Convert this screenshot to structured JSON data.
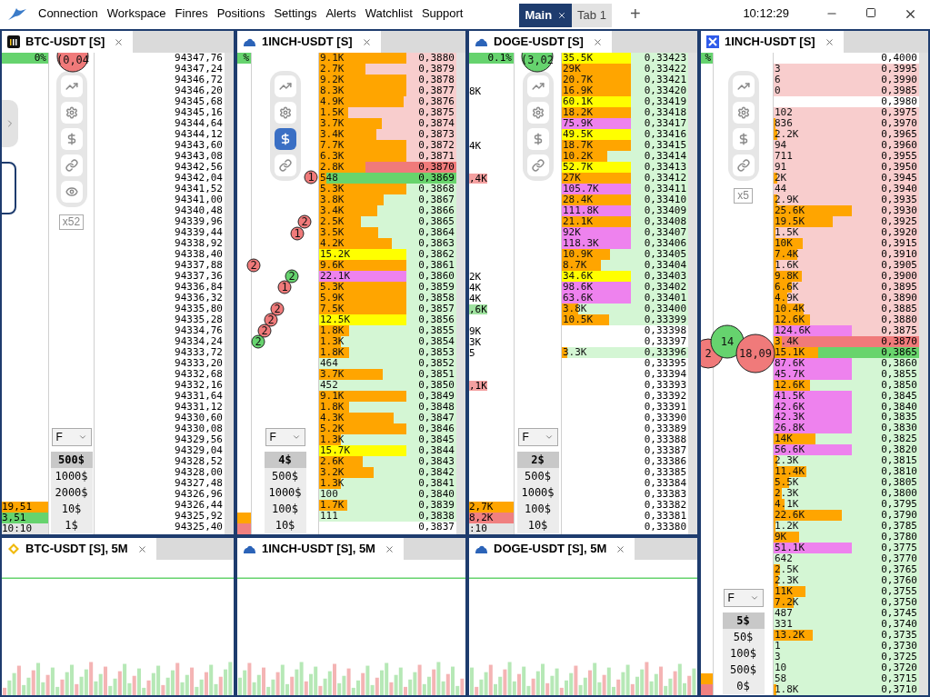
{
  "menu": [
    "Connection",
    "Workspace",
    "Finres",
    "Positions",
    "Settings",
    "Alerts",
    "Watchlist",
    "Support"
  ],
  "tabs": [
    {
      "label": "Main",
      "selected": true
    },
    {
      "label": "Tab 1",
      "selected": false
    }
  ],
  "add_tab": "+",
  "clock": "10:12:29",
  "ladders": [
    {
      "title": "BTC-USDT [S]",
      "percent": "0%",
      "trades": [
        {
          "label": "(0,04",
          "color": "#f07a7a"
        }
      ],
      "tools": [
        {
          "kind": "trend",
          "selected": false
        },
        {
          "kind": "settings",
          "selected": false
        },
        {
          "kind": "dollar",
          "selected": false
        },
        {
          "kind": "link",
          "selected": false
        },
        {
          "kind": "eye",
          "selected": false
        }
      ],
      "multiplier": "x52",
      "mode": "F",
      "sizes": [
        {
          "label": "500$",
          "selected": true
        },
        {
          "label": "1000$",
          "selected": false
        },
        {
          "label": "2000$",
          "selected": false
        },
        {
          "label": "10$",
          "selected": false
        },
        {
          "label": "1$",
          "selected": false
        }
      ],
      "footer": [
        {
          "text": "19,51",
          "color": "#ffa500"
        },
        {
          "text": "3,51",
          "color": "#66d36e"
        },
        {
          "text": "10:10",
          "color": "#e4e4e4"
        }
      ],
      "rows": [
        {
          "price": "94347,76"
        },
        {
          "price": "94347,24"
        },
        {
          "price": "94346,72"
        },
        {
          "price": "94346,20"
        },
        {
          "price": "94345,68"
        },
        {
          "price": "94345,16"
        },
        {
          "price": "94344,64"
        },
        {
          "price": "94344,12"
        },
        {
          "price": "94343,60"
        },
        {
          "price": "94343,08"
        },
        {
          "price": "94342,56"
        },
        {
          "price": "94342,04"
        },
        {
          "price": "94341,52"
        },
        {
          "price": "94341,00"
        },
        {
          "price": "94340,48"
        },
        {
          "price": "94339,96"
        },
        {
          "price": "94339,44"
        },
        {
          "price": "94338,92"
        },
        {
          "price": "94338,40"
        },
        {
          "price": "94337,88"
        },
        {
          "price": "94337,36"
        },
        {
          "price": "94336,84"
        },
        {
          "price": "94336,32"
        },
        {
          "price": "94335,80"
        },
        {
          "price": "94335,28"
        },
        {
          "price": "94334,76"
        },
        {
          "price": "94334,24"
        },
        {
          "price": "94333,72"
        },
        {
          "price": "94333,20"
        },
        {
          "price": "94332,68"
        },
        {
          "price": "94332,16"
        },
        {
          "price": "94331,64"
        },
        {
          "price": "94331,12"
        },
        {
          "price": "94330,60"
        },
        {
          "price": "94330,08"
        },
        {
          "price": "94329,56"
        },
        {
          "price": "94329,04"
        },
        {
          "price": "94328,52"
        },
        {
          "price": "94328,00"
        },
        {
          "price": "94327,48"
        },
        {
          "price": "94326,96"
        },
        {
          "price": "94326,44"
        },
        {
          "price": "94325,92"
        },
        {
          "price": "94325,40"
        }
      ]
    },
    {
      "title": "1INCH-USDT [S]",
      "percent": "%",
      "trades": [
        {
          "label": "1",
          "color": "#f07a7a"
        },
        {
          "label": "2",
          "color": "#f07a7a"
        },
        {
          "label": "1",
          "color": "#f07a7a"
        },
        {
          "label": "2",
          "color": "#f07a7a"
        },
        {
          "label": "2",
          "color": "#66d36e"
        },
        {
          "label": "1",
          "color": "#f07a7a"
        },
        {
          "label": "2",
          "color": "#f07a7a"
        },
        {
          "label": "2",
          "color": "#f07a7a"
        },
        {
          "label": "2",
          "color": "#f07a7a"
        },
        {
          "label": "2",
          "color": "#66d36e"
        }
      ],
      "tools": [
        {
          "kind": "trend",
          "selected": false
        },
        {
          "kind": "settings",
          "selected": false
        },
        {
          "kind": "dollar",
          "selected": true
        },
        {
          "kind": "link",
          "selected": false
        }
      ],
      "mode": "F",
      "sizes": [
        {
          "label": "4$",
          "selected": true
        },
        {
          "label": "500$",
          "selected": false
        },
        {
          "label": "1000$",
          "selected": false
        },
        {
          "label": "100$",
          "selected": false
        },
        {
          "label": "10$",
          "selected": false
        }
      ],
      "footer": [
        {
          "color": "#ffa500"
        },
        {
          "color": "#f08080"
        }
      ],
      "rows": [
        {
          "price": "0,3880",
          "volume": "9.1K",
          "level": 1,
          "color": "#ffa500",
          "kind": "ask"
        },
        {
          "price": "0,3879",
          "volume": "2.7K",
          "level": 0.53,
          "color": "#ffa500",
          "kind": "ask"
        },
        {
          "price": "0,3878",
          "volume": "9.2K",
          "level": 1,
          "color": "#ffa500",
          "kind": "ask"
        },
        {
          "price": "0,3877",
          "volume": "8.3K",
          "level": 1,
          "color": "#ffa500",
          "kind": "ask"
        },
        {
          "price": "0,3876",
          "volume": "4.9K",
          "level": 0.97,
          "color": "#ffa500",
          "kind": "ask"
        },
        {
          "price": "0,3875",
          "volume": "1.5K",
          "level": 0.33,
          "color": "#ffa500",
          "kind": "ask"
        },
        {
          "price": "0,3874",
          "volume": "3.7K",
          "level": 0.72,
          "color": "#ffa500",
          "kind": "ask"
        },
        {
          "price": "0,3873",
          "volume": "3.4K",
          "level": 0.66,
          "color": "#ffa500",
          "kind": "ask"
        },
        {
          "price": "0,3872",
          "volume": "7.7K",
          "level": 1,
          "color": "#ffa500",
          "kind": "ask"
        },
        {
          "price": "0,3871",
          "volume": "6.3K",
          "level": 1,
          "color": "#ffa500",
          "kind": "ask"
        },
        {
          "price": "0,3870",
          "volume": "2.8K",
          "level": 0.53,
          "color": "#ffa500",
          "kind": "best_ask"
        },
        {
          "price": "0,3869",
          "volume": "548",
          "level": 0.08,
          "color": "#ffa500",
          "kind": "best_bid"
        },
        {
          "price": "0,3868",
          "volume": "5.3K",
          "level": 1,
          "color": "#ffa500",
          "kind": "bid"
        },
        {
          "price": "0,3867",
          "volume": "3.8K",
          "level": 0.74,
          "color": "#ffa500",
          "kind": "bid"
        },
        {
          "price": "0,3866",
          "volume": "3.4K",
          "level": 0.67,
          "color": "#ffa500",
          "kind": "bid"
        },
        {
          "price": "0,3865",
          "volume": "2.5K",
          "level": 0.48,
          "color": "#ffa500",
          "kind": "bid"
        },
        {
          "price": "0,3864",
          "volume": "3.5K",
          "level": 0.68,
          "color": "#ffa500",
          "kind": "bid"
        },
        {
          "price": "0,3863",
          "volume": "4.2K",
          "level": 0.83,
          "color": "#ffa500",
          "kind": "bid"
        },
        {
          "price": "0,3862",
          "volume": "15.2K",
          "level": 1,
          "color": "#ffff00",
          "kind": "bid"
        },
        {
          "price": "0,3861",
          "volume": "9.6K",
          "level": 1,
          "color": "#ffa500",
          "kind": "bid"
        },
        {
          "price": "0,3860",
          "volume": "22.1K",
          "level": 1,
          "color": "#ee82ee",
          "kind": "bid"
        },
        {
          "price": "0,3859",
          "volume": "5.3K",
          "level": 1,
          "color": "#ffa500",
          "kind": "bid"
        },
        {
          "price": "0,3858",
          "volume": "5.9K",
          "level": 1,
          "color": "#ffa500",
          "kind": "bid"
        },
        {
          "price": "0,3857",
          "volume": "7.5K",
          "level": 1,
          "color": "#ffa500",
          "kind": "bid"
        },
        {
          "price": "0,3856",
          "volume": "12.5K",
          "level": 1,
          "color": "#ffff00",
          "kind": "bid"
        },
        {
          "price": "0,3855",
          "volume": "1.8K",
          "level": 0.34,
          "color": "#ffa500",
          "kind": "bid"
        },
        {
          "price": "0,3854",
          "volume": "1.3K",
          "level": 0.25,
          "color": "#ffa500",
          "kind": "bid"
        },
        {
          "price": "0,3853",
          "volume": "1.8K",
          "level": 0.34,
          "color": "#ffa500",
          "kind": "bid"
        },
        {
          "price": "0,3852",
          "volume": "464",
          "kind": "bid"
        },
        {
          "price": "0,3851",
          "volume": "3.7K",
          "level": 0.73,
          "color": "#ffa500",
          "kind": "bid"
        },
        {
          "price": "0,3850",
          "volume": "452",
          "kind": "bid"
        },
        {
          "price": "0,3849",
          "volume": "9.1K",
          "level": 1,
          "color": "#ffa500",
          "kind": "bid"
        },
        {
          "price": "0,3848",
          "volume": "1.8K",
          "level": 0.34,
          "color": "#ffa500",
          "kind": "bid"
        },
        {
          "price": "0,3847",
          "volume": "4.3K",
          "level": 0.85,
          "color": "#ffa500",
          "kind": "bid"
        },
        {
          "price": "0,3846",
          "volume": "5.2K",
          "level": 1,
          "color": "#ffa500",
          "kind": "bid"
        },
        {
          "price": "0,3845",
          "volume": "1.3K",
          "level": 0.25,
          "color": "#ffa500",
          "kind": "bid"
        },
        {
          "price": "0,3844",
          "volume": "15.7K",
          "level": 1,
          "color": "#ffff00",
          "kind": "bid"
        },
        {
          "price": "0,3843",
          "volume": "2.6K",
          "level": 0.5,
          "color": "#ffa500",
          "kind": "bid"
        },
        {
          "price": "0,3842",
          "volume": "3.2K",
          "level": 0.62,
          "color": "#ffa500",
          "kind": "bid"
        },
        {
          "price": "0,3841",
          "volume": "1.3K",
          "level": 0.25,
          "color": "#ffa500",
          "kind": "bid"
        },
        {
          "price": "0,3840",
          "volume": "100",
          "kind": "bid"
        },
        {
          "price": "0,3839",
          "volume": "1.7K",
          "level": 0.32,
          "color": "#ffa500",
          "kind": "bid"
        },
        {
          "price": "0,3838",
          "volume": "111",
          "kind": "bid"
        },
        {
          "price": "0,3837"
        }
      ]
    },
    {
      "title": "DOGE-USDT [S]",
      "percent": "0.1%",
      "trades": [
        {
          "label": "(3,02",
          "color": "#66d36e"
        }
      ],
      "tools": [
        {
          "kind": "trend",
          "selected": false
        },
        {
          "kind": "settings",
          "selected": false
        },
        {
          "kind": "dollar",
          "selected": false
        },
        {
          "kind": "link",
          "selected": false
        }
      ],
      "mode": "F",
      "sizes": [
        {
          "label": "2$",
          "selected": true
        },
        {
          "label": "500$",
          "selected": false
        },
        {
          "label": "1000$",
          "selected": false
        },
        {
          "label": "100$",
          "selected": false
        },
        {
          "label": "10$",
          "selected": false
        }
      ],
      "footer": [
        {
          "text": "2,7K",
          "color": "#ffa500"
        },
        {
          "text": "8,2K",
          "color": "#f08080"
        },
        {
          "text": ":10",
          "color": "#e4e4e4"
        }
      ],
      "rows": [
        {
          "price": "0,33423",
          "volume": "35.5K",
          "level": 1,
          "color": "#ffff00",
          "kind": "bid"
        },
        {
          "price": "0,33422",
          "volume": "29K",
          "level": 1,
          "color": "#ffa500",
          "kind": "bid"
        },
        {
          "price": "0,33421",
          "volume": "20.7K",
          "level": 1,
          "color": "#ffa500",
          "kind": "bid"
        },
        {
          "price": "0,33420",
          "volume": "16.9K",
          "level": 1,
          "color": "#ffa500",
          "kind": "bid",
          "cluster": {
            "text": "8K"
          }
        },
        {
          "price": "0,33419",
          "volume": "60.1K",
          "level": 1,
          "color": "#ffff00",
          "kind": "bid"
        },
        {
          "price": "0,33418",
          "volume": "18.2K",
          "level": 1,
          "color": "#ffa500",
          "kind": "bid"
        },
        {
          "price": "0,33417",
          "volume": "75.9K",
          "level": 1,
          "color": "#ee82ee",
          "kind": "bid"
        },
        {
          "price": "0,33416",
          "volume": "49.5K",
          "level": 1,
          "color": "#ffff00",
          "kind": "bid"
        },
        {
          "price": "0,33415",
          "volume": "18.7K",
          "level": 1,
          "color": "#ffa500",
          "kind": "bid",
          "cluster": {
            "text": "4K"
          }
        },
        {
          "price": "0,33414",
          "volume": "10.2K",
          "level": 0.66,
          "color": "#ffa500",
          "kind": "bid"
        },
        {
          "price": "0,33413",
          "volume": "52.7K",
          "level": 1,
          "color": "#ffff00",
          "kind": "bid"
        },
        {
          "price": "0,33412",
          "volume": "27K",
          "level": 1,
          "color": "#ffa500",
          "kind": "bid",
          "cluster": {
            "text": ",4K",
            "color": "#f4a0a0"
          }
        },
        {
          "price": "0,33411",
          "volume": "105.7K",
          "level": 1,
          "color": "#ee82ee",
          "kind": "bid"
        },
        {
          "price": "0,33410",
          "volume": "28.4K",
          "level": 1,
          "color": "#ffa500",
          "kind": "bid"
        },
        {
          "price": "0,33409",
          "volume": "111.8K",
          "level": 1,
          "color": "#ee82ee",
          "kind": "bid"
        },
        {
          "price": "0,33408",
          "volume": "21.1K",
          "level": 1,
          "color": "#ffa500",
          "kind": "bid"
        },
        {
          "price": "0,33407",
          "volume": "92K",
          "level": 1,
          "color": "#ee82ee",
          "kind": "bid"
        },
        {
          "price": "0,33406",
          "volume": "118.3K",
          "level": 1,
          "color": "#ee82ee",
          "kind": "bid"
        },
        {
          "price": "0,33405",
          "volume": "10.9K",
          "level": 0.7,
          "color": "#ffa500",
          "kind": "bid"
        },
        {
          "price": "0,33404",
          "volume": "8.7K",
          "level": 0.56,
          "color": "#ffa500",
          "kind": "bid"
        },
        {
          "price": "0,33403",
          "volume": "34.6K",
          "level": 1,
          "color": "#ffff00",
          "kind": "bid",
          "cluster": {
            "text": "2K"
          }
        },
        {
          "price": "0,33402",
          "volume": "98.6K",
          "level": 1,
          "color": "#ee82ee",
          "kind": "bid",
          "cluster": {
            "text": "4K"
          }
        },
        {
          "price": "0,33401",
          "volume": "63.6K",
          "level": 1,
          "color": "#ee82ee",
          "kind": "bid",
          "cluster": {
            "text": "4K"
          }
        },
        {
          "price": "0,33400",
          "volume": "3.8K",
          "level": 0.24,
          "color": "#ffa500",
          "kind": "bid",
          "cluster": {
            "text": ",6K",
            "color": "#9fe29f"
          }
        },
        {
          "price": "0,33399",
          "volume": "10.5K",
          "level": 0.68,
          "color": "#ffa500",
          "kind": "bid"
        },
        {
          "price": "0,33398",
          "cluster": {
            "text": "9K"
          }
        },
        {
          "price": "0,33397",
          "cluster": {
            "text": "3K"
          }
        },
        {
          "price": "0,33396",
          "volume": "3.3K",
          "level": 0.08,
          "color": "#ffa500",
          "kind": "bid",
          "cluster": {
            "text": "5"
          }
        },
        {
          "price": "0,33395"
        },
        {
          "price": "0,33394"
        },
        {
          "price": "0,33393",
          "cluster": {
            "text": ",1K",
            "color": "#f4a0a0"
          }
        },
        {
          "price": "0,33392"
        },
        {
          "price": "0,33391"
        },
        {
          "price": "0,33390"
        },
        {
          "price": "0,33389"
        },
        {
          "price": "0,33388"
        },
        {
          "price": "0,33387"
        },
        {
          "price": "0,33386"
        },
        {
          "price": "0,33385"
        },
        {
          "price": "0,33384"
        },
        {
          "price": "0,33383"
        },
        {
          "price": "0,33382"
        },
        {
          "price": "0,33381"
        },
        {
          "price": "0,33380"
        }
      ]
    },
    {
      "title": "1INCH-USDT [S]",
      "percent": "%",
      "trades": [
        {
          "label": "2",
          "color": "#f07a7a"
        },
        {
          "label": "14",
          "color": "#66d36e"
        },
        {
          "label": "18,09",
          "color": "#f07a7a"
        }
      ],
      "tools": [
        {
          "kind": "trend",
          "selected": false
        },
        {
          "kind": "settings",
          "selected": false
        },
        {
          "kind": "dollar",
          "selected": false
        },
        {
          "kind": "link",
          "selected": false
        }
      ],
      "multiplier": "x5",
      "mode": "F",
      "sizes": [
        {
          "label": "5$",
          "selected": true
        },
        {
          "label": "50$",
          "selected": false
        },
        {
          "label": "100$",
          "selected": false
        },
        {
          "label": "500$",
          "selected": false
        },
        {
          "label": "0$",
          "selected": false
        }
      ],
      "footer": [
        {
          "color": "#ffa500"
        },
        {
          "color": "#f08080"
        }
      ],
      "rows": [
        {
          "price": "0,4000"
        },
        {
          "price": "0,3995",
          "volume": "3",
          "kind": "ask"
        },
        {
          "price": "0,3990",
          "volume": "6",
          "kind": "ask"
        },
        {
          "price": "0,3985",
          "volume": "0",
          "kind": "ask"
        },
        {
          "price": "0,3980"
        },
        {
          "price": "0,3975",
          "volume": "102",
          "kind": "ask"
        },
        {
          "price": "0,3970",
          "volume": "836",
          "level": 0.02,
          "color": "#ffa500",
          "kind": "ask"
        },
        {
          "price": "0,3965",
          "volume": "2.2K",
          "level": 0.05,
          "color": "#ffa500",
          "kind": "ask"
        },
        {
          "price": "0,3960",
          "volume": "94",
          "kind": "ask"
        },
        {
          "price": "0,3955",
          "volume": "711",
          "kind": "ask"
        },
        {
          "price": "0,3950",
          "volume": "91",
          "kind": "ask"
        },
        {
          "price": "0,3945",
          "volume": "2K",
          "level": 0.05,
          "color": "#ffa500",
          "kind": "ask"
        },
        {
          "price": "0,3940",
          "volume": "44",
          "kind": "ask"
        },
        {
          "price": "0,3935",
          "volume": "2.9K",
          "level": 0.05,
          "color": "#ffa500",
          "kind": "ask"
        },
        {
          "price": "0,3930",
          "volume": "25.6K",
          "level": 1,
          "color": "#ffa500",
          "kind": "ask"
        },
        {
          "price": "0,3925",
          "volume": "19.5K",
          "level": 0.75,
          "color": "#ffa500",
          "kind": "ask"
        },
        {
          "price": "0,3920",
          "volume": "1.5K",
          "level": 0.02,
          "color": "#ffa500",
          "kind": "ask"
        },
        {
          "price": "0,3915",
          "volume": "10K",
          "level": 0.37,
          "color": "#ffa500",
          "kind": "ask"
        },
        {
          "price": "0,3910",
          "volume": "7.4K",
          "level": 0.3,
          "color": "#ffa500",
          "kind": "ask"
        },
        {
          "price": "0,3905",
          "volume": "1.6K",
          "level": 0.03,
          "color": "#ffa500",
          "kind": "ask"
        },
        {
          "price": "0,3900",
          "volume": "9.8K",
          "level": 0.36,
          "color": "#ffa500",
          "kind": "ask"
        },
        {
          "price": "0,3895",
          "volume": "6.6K",
          "level": 0.23,
          "color": "#ffa500",
          "kind": "ask"
        },
        {
          "price": "0,3890",
          "volume": "4.9K",
          "level": 0.17,
          "color": "#ffa500",
          "kind": "ask"
        },
        {
          "price": "0,3885",
          "volume": "10.4K",
          "level": 0.38,
          "color": "#ffa500",
          "kind": "ask"
        },
        {
          "price": "0,3880",
          "volume": "12.6K",
          "level": 0.47,
          "color": "#ffa500",
          "kind": "ask"
        },
        {
          "price": "0,3875",
          "volume": "124.6K",
          "level": 1,
          "color": "#ee82ee",
          "kind": "ask"
        },
        {
          "price": "0,3870",
          "volume": "3.4K",
          "level": 0.1,
          "color": "#ffa500",
          "kind": "best_ask"
        },
        {
          "price": "0,3865",
          "volume": "15.1K",
          "level": 0.57,
          "color": "#ffa500",
          "kind": "best_bid"
        },
        {
          "price": "0,3860",
          "volume": "87.6K",
          "level": 1,
          "color": "#ee82ee",
          "kind": "bid"
        },
        {
          "price": "0,3855",
          "volume": "45.7K",
          "level": 1,
          "color": "#ee82ee",
          "kind": "bid"
        },
        {
          "price": "0,3850",
          "volume": "12.6K",
          "level": 0.47,
          "color": "#ffa500",
          "kind": "bid"
        },
        {
          "price": "0,3845",
          "volume": "41.5K",
          "level": 1,
          "color": "#ee82ee",
          "kind": "bid"
        },
        {
          "price": "0,3840",
          "volume": "42.6K",
          "level": 1,
          "color": "#ee82ee",
          "kind": "bid"
        },
        {
          "price": "0,3835",
          "volume": "42.3K",
          "level": 1,
          "color": "#ee82ee",
          "kind": "bid"
        },
        {
          "price": "0,3830",
          "volume": "26.8K",
          "level": 1,
          "color": "#ee82ee",
          "kind": "bid"
        },
        {
          "price": "0,3825",
          "volume": "14K",
          "level": 0.53,
          "color": "#ffa500",
          "kind": "bid"
        },
        {
          "price": "0,3820",
          "volume": "56.6K",
          "level": 1,
          "color": "#ee82ee",
          "kind": "bid"
        },
        {
          "price": "0,3815",
          "volume": "2.3K",
          "level": 0.05,
          "color": "#ffa500",
          "kind": "bid"
        },
        {
          "price": "0,3810",
          "volume": "11.4K",
          "level": 0.42,
          "color": "#ffa500",
          "kind": "bid"
        },
        {
          "price": "0,3805",
          "volume": "5.5K",
          "level": 0.2,
          "color": "#ffa500",
          "kind": "bid"
        },
        {
          "price": "0,3800",
          "volume": "2.3K",
          "level": 0.1,
          "color": "#ffa500",
          "kind": "bid"
        },
        {
          "price": "0,3795",
          "volume": "4.1K",
          "level": 0.14,
          "color": "#ffa500",
          "kind": "bid"
        },
        {
          "price": "0,3790",
          "volume": "22.6K",
          "level": 0.87,
          "color": "#ffa500",
          "kind": "bid"
        },
        {
          "price": "0,3785",
          "volume": "1.2K",
          "level": 0.02,
          "color": "#ffa500",
          "kind": "bid"
        },
        {
          "price": "0,3780",
          "volume": "9K",
          "level": 0.33,
          "color": "#ffa500",
          "kind": "bid"
        },
        {
          "price": "0,3775",
          "volume": "51.1K",
          "level": 1,
          "color": "#ee82ee",
          "kind": "bid"
        },
        {
          "price": "0,3770",
          "volume": "642",
          "kind": "bid"
        },
        {
          "price": "0,3765",
          "volume": "2.5K",
          "level": 0.08,
          "color": "#ffa500",
          "kind": "bid"
        },
        {
          "price": "0,3760",
          "volume": "2.3K",
          "level": 0.06,
          "color": "#ffa500",
          "kind": "bid"
        },
        {
          "price": "0,3755",
          "volume": "11K",
          "level": 0.41,
          "color": "#ffa500",
          "kind": "bid"
        },
        {
          "price": "0,3750",
          "volume": "7.2K",
          "level": 0.26,
          "color": "#ffa500",
          "kind": "bid"
        },
        {
          "price": "0,3745",
          "volume": "487",
          "kind": "bid"
        },
        {
          "price": "0,3740",
          "volume": "331",
          "kind": "bid"
        },
        {
          "price": "0,3735",
          "volume": "13.2K",
          "level": 0.5,
          "color": "#ffa500",
          "kind": "bid"
        },
        {
          "price": "0,3730",
          "volume": "1",
          "kind": "bid"
        },
        {
          "price": "0,3725",
          "volume": "3",
          "kind": "bid"
        },
        {
          "price": "0,3720",
          "volume": "10",
          "kind": "bid"
        },
        {
          "price": "0,3715",
          "volume": "58",
          "kind": "bid"
        },
        {
          "price": "0,3710",
          "volume": "1.8K",
          "level": 0.04,
          "color": "#ffa500",
          "kind": "bid"
        }
      ]
    }
  ],
  "charts": [
    {
      "title": "BTC-USDT [S], 5M"
    },
    {
      "title": "1INCH-USDT [S], 5M"
    },
    {
      "title": "DOGE-USDT [S], 5M"
    }
  ]
}
